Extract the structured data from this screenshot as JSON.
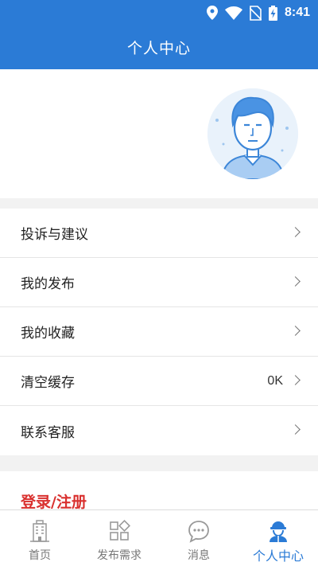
{
  "status_bar": {
    "time": "8:41",
    "icons": [
      "location-icon",
      "wifi-icon",
      "no-sim-icon",
      "battery-charging-icon"
    ]
  },
  "header": {
    "title": "个人中心"
  },
  "profile": {
    "avatar_icon": "user-avatar"
  },
  "menu": {
    "items": [
      {
        "label": "投诉与建议",
        "value": ""
      },
      {
        "label": "我的发布",
        "value": ""
      },
      {
        "label": "我的收藏",
        "value": ""
      },
      {
        "label": "清空缓存",
        "value": "0K"
      },
      {
        "label": "联系客服",
        "value": ""
      }
    ]
  },
  "login": {
    "label": "登录/注册"
  },
  "tabs": [
    {
      "label": "首页",
      "icon": "building-icon",
      "active": false
    },
    {
      "label": "发布需求",
      "icon": "grid-icon",
      "active": false
    },
    {
      "label": "消息",
      "icon": "chat-bubble-icon",
      "active": false
    },
    {
      "label": "个人中心",
      "icon": "worker-icon",
      "active": true
    }
  ],
  "colors": {
    "primary": "#2b7bd6",
    "login_red": "#d9302e"
  }
}
